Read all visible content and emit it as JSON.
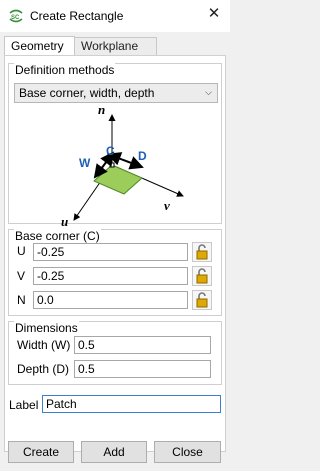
{
  "window": {
    "title": "Create Rectangle",
    "close_glyph": "✕"
  },
  "tabs": [
    {
      "label": "Geometry",
      "active": true
    },
    {
      "label": "Workplane",
      "active": false
    }
  ],
  "definition": {
    "group_label": "Definition methods",
    "method_selected": "Base corner, width, depth",
    "diagram_labels": {
      "n": "n",
      "u": "u",
      "v": "v",
      "w": "W",
      "c": "C",
      "d": "D"
    }
  },
  "base_corner": {
    "group_label": "Base corner (C)",
    "fields": [
      {
        "label": "U",
        "value": "-0.25"
      },
      {
        "label": "V",
        "value": "-0.25"
      },
      {
        "label": "N",
        "value": "0.0"
      }
    ]
  },
  "dimensions": {
    "group_label": "Dimensions",
    "fields": [
      {
        "label": "Width (W)",
        "value": "0.5"
      },
      {
        "label": "Depth (D)",
        "value": "0.5"
      }
    ]
  },
  "label_field": {
    "label": "Label",
    "value": "Patch"
  },
  "buttons": {
    "create": "Create",
    "add": "Add",
    "close": "Close"
  },
  "colors": {
    "accent_blue": "#1f5fb5",
    "patch_green": "#9ccc5a",
    "lock_gold": "#e0a800",
    "label_border": "#3c7fd0"
  }
}
